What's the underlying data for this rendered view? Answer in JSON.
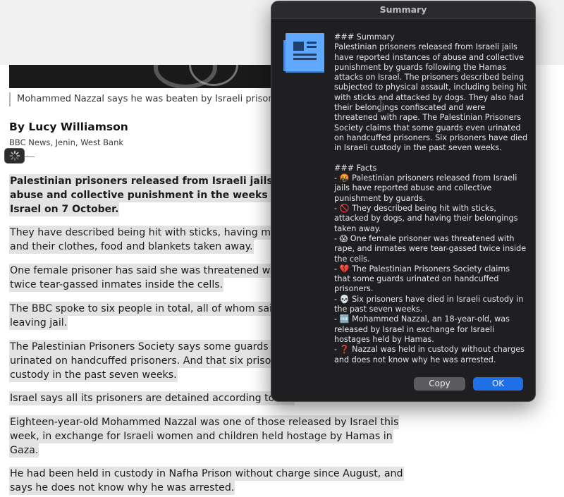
{
  "article": {
    "caption": "Mohammed Nazzal says he was beaten by Israeli prison guards",
    "byline": "By Lucy Williamson",
    "byline_sub": "BBC News, Jenin, West Bank",
    "paragraphs": [
      {
        "bold": true,
        "lines": [
          "Palestinian prisoners released from Israeli jails say that",
          "abuse and collective punishment in the weeks after the",
          "Israel on 7 October."
        ]
      },
      {
        "bold": false,
        "lines": [
          "They have described being hit with sticks, having muzzle",
          "and their clothes, food and blankets taken away."
        ]
      },
      {
        "bold": false,
        "lines": [
          "One female prisoner has said she was threatened with ra",
          "twice tear-gassed inmates inside the cells."
        ]
      },
      {
        "bold": false,
        "lines": [
          "The BBC spoke to six people in total, all of whom said th",
          "leaving jail."
        ]
      },
      {
        "bold": false,
        "lines": [
          "The Palestinian Prisoners Society says some guards are a",
          "urinated on handcuffed prisoners. And that six prisoners",
          "custody in the past seven weeks."
        ]
      },
      {
        "bold": false,
        "lines": [
          "Israel says all its prisoners are detained according to the"
        ]
      },
      {
        "bold": false,
        "lines": [
          "Eighteen-year-old Mohammed Nazzal was one of those released by Israel this",
          "week, in exchange for Israeli women and children held hostage by Hamas in",
          "Gaza."
        ]
      },
      {
        "bold": false,
        "lines": [
          "He had been held in custody in Nafha Prison without charge since August, and",
          "says he does not know why he was arrested."
        ]
      }
    ]
  },
  "dialog": {
    "title": "Summary",
    "lines": [
      "### Summary",
      "Palestinian prisoners released from Israeli jails",
      "have reported instances of abuse and collective",
      "punishment by guards following the Hamas",
      "attacks on Israel. The prisoners described being",
      "subjected to physical assault, including being hit",
      "with sticks and attacked by dogs. They also had",
      "their belongings confiscated and were",
      "threatened with rape. The Palestinian Prisoners",
      "Society claims that some guards even urinated",
      "on handcuffed prisoners. Six prisoners have died",
      "in Israeli custody in the past seven weeks.",
      "",
      "### Facts",
      "- 🤬 Palestinian prisoners released from Israeli",
      "jails have reported abuse and collective",
      "punishment by guards.",
      "- 🚫 They described being hit with sticks,",
      "attacked by dogs, and having their belongings",
      "taken away.",
      "- 😱 One female prisoner was threatened with",
      "rape, and inmates were tear-gassed twice inside",
      "the cells.",
      "- 💔 The Palestinian Prisoners Society claims",
      "that some guards urinated on handcuffed",
      "prisoners.",
      "- 💀 Six prisoners have died in Israeli custody in",
      "the past seven weeks.",
      "- 🆓 Mohammed Nazzal, an 18-year-old, was",
      "released by Israel in exchange for Israeli",
      "hostages held by Hamas.",
      "- ❓ Nazzal was held in custody without charges",
      "and does not know why he was arrested."
    ],
    "copy_label": "Copy",
    "ok_label": "OK"
  },
  "colors": {
    "dialog_bg": "#1f1f21",
    "ok_button": "#1f6fe6",
    "copy_button": "#5b5b5f",
    "doc_icon": "#5fa8ff",
    "highlight": "#e3e3e3"
  },
  "icons": [
    "document-icon",
    "spinner-icon",
    "text-cursor-icon"
  ]
}
